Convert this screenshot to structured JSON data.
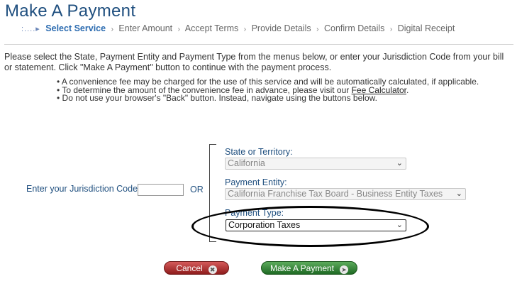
{
  "page": {
    "title": "Make A Payment"
  },
  "wizard": {
    "steps": [
      "Select Service",
      "Enter Amount",
      "Accept Terms",
      "Provide Details",
      "Confirm Details",
      "Digital Receipt"
    ],
    "active_index": 0
  },
  "intro": "Please select the State, Payment Entity and Payment Type from the menus below, or enter your Jurisdiction Code from your bill or statement. Click \"Make A Payment\" button to continue with the payment process.",
  "notes": {
    "line1": "A convenience fee may be charged for the use of this service and will be automatically calculated, if applicable.",
    "line2_prefix": "To determine the amount of the convenience fee in advance, please visit our",
    "line2_link": "Fee Calculator",
    "line2_suffix": ".",
    "line3": "Do not use your browser's \"Back\" button. Instead, navigate using the buttons below."
  },
  "jurisdiction": {
    "label": "Enter your Jurisdiction Code:",
    "value": "",
    "or_label": "OR"
  },
  "form": {
    "state": {
      "label": "State or Territory:",
      "value": "California"
    },
    "entity": {
      "label": "Payment Entity:",
      "value": "California Franchise Tax Board - Business Entity Taxes"
    },
    "type": {
      "label": "Payment Type:",
      "value": "Corporation Taxes"
    }
  },
  "buttons": {
    "cancel": "Cancel",
    "make_payment": "Make A Payment"
  },
  "colors": {
    "heading": "#1f4f7f",
    "active_step": "#2b6bb0",
    "cancel_button": "#a32626",
    "pay_button": "#2e7d32"
  }
}
